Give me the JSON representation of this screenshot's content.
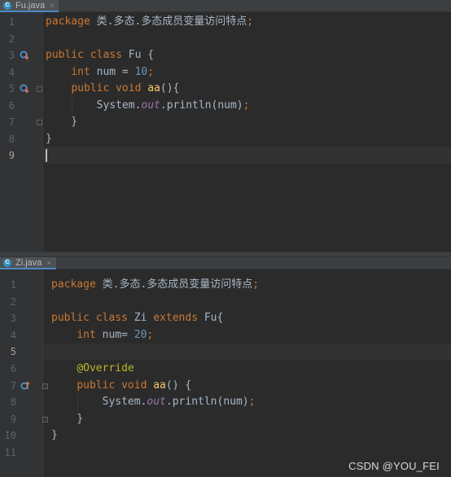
{
  "editor_top": {
    "tab": {
      "icon_letter": "C",
      "title": "Fu.java",
      "close_glyph": "×"
    },
    "lines": [
      {
        "no": "1",
        "code": [
          [
            "kw",
            "package "
          ],
          [
            "p",
            "类.多态.多态成员变量访问特点"
          ],
          [
            "kw",
            ";"
          ]
        ]
      },
      {
        "no": "2",
        "code": []
      },
      {
        "no": "3",
        "code": [
          [
            "kw",
            "public class "
          ],
          [
            "p",
            "Fu {"
          ]
        ]
      },
      {
        "no": "4",
        "code": [
          [
            "p",
            "    "
          ],
          [
            "kw",
            "int "
          ],
          [
            "p",
            "num = "
          ],
          [
            "num",
            "10"
          ],
          [
            "kw",
            ";"
          ]
        ]
      },
      {
        "no": "5",
        "code": [
          [
            "p",
            "    "
          ],
          [
            "kw",
            "public void "
          ],
          [
            "fn",
            "aa"
          ],
          [
            "p",
            "(){"
          ]
        ]
      },
      {
        "no": "6",
        "code": [
          [
            "p",
            "        System."
          ],
          [
            "field",
            "out"
          ],
          [
            "p",
            ".println(num)"
          ],
          [
            "kw",
            ";"
          ]
        ]
      },
      {
        "no": "7",
        "code": [
          [
            "p",
            "    }"
          ]
        ]
      },
      {
        "no": "8",
        "code": [
          [
            "p",
            "}"
          ]
        ]
      },
      {
        "no": "9",
        "code": []
      }
    ],
    "gutter_icons": [
      {
        "line": "3",
        "icon": "overridden-down-icon"
      },
      {
        "line": "5",
        "icon": "overridden-down-icon"
      }
    ]
  },
  "editor_bottom": {
    "tab": {
      "icon_letter": "C",
      "title": "Zi.java",
      "close_glyph": "×"
    },
    "lines": [
      {
        "no": "1",
        "code": [
          [
            "kw",
            "package "
          ],
          [
            "p",
            "类.多态.多态成员变量访问特点"
          ],
          [
            "kw",
            ";"
          ]
        ]
      },
      {
        "no": "2",
        "code": []
      },
      {
        "no": "3",
        "code": [
          [
            "kw",
            "public class "
          ],
          [
            "p",
            "Zi "
          ],
          [
            "kw",
            "extends "
          ],
          [
            "p",
            "Fu{"
          ]
        ]
      },
      {
        "no": "4",
        "code": [
          [
            "p",
            "    "
          ],
          [
            "kw",
            "int "
          ],
          [
            "p",
            "num= "
          ],
          [
            "num",
            "20"
          ],
          [
            "kw",
            ";"
          ]
        ]
      },
      {
        "no": "5",
        "code": []
      },
      {
        "no": "6",
        "code": [
          [
            "p",
            "    "
          ],
          [
            "ann",
            "@Override"
          ]
        ]
      },
      {
        "no": "7",
        "code": [
          [
            "p",
            "    "
          ],
          [
            "kw",
            "public void "
          ],
          [
            "fn",
            "aa"
          ],
          [
            "p",
            "() {"
          ]
        ]
      },
      {
        "no": "8",
        "code": [
          [
            "p",
            "        System."
          ],
          [
            "field",
            "out"
          ],
          [
            "p",
            ".println(num)"
          ],
          [
            "kw",
            ";"
          ]
        ]
      },
      {
        "no": "9",
        "code": [
          [
            "p",
            "    }"
          ]
        ]
      },
      {
        "no": "10",
        "code": [
          [
            "p",
            "}"
          ]
        ]
      },
      {
        "no": "11",
        "code": []
      }
    ],
    "gutter_icons": [
      {
        "line": "7",
        "icon": "overrides-up-icon"
      }
    ]
  },
  "watermark": "CSDN @YOU_FEI",
  "colors": {
    "background": "#2b2b2b",
    "keyword": "#cc7832",
    "number": "#6897bb",
    "field": "#9876aa",
    "method": "#ffc66d",
    "annotation": "#bbb529",
    "text": "#a9b7c6"
  }
}
